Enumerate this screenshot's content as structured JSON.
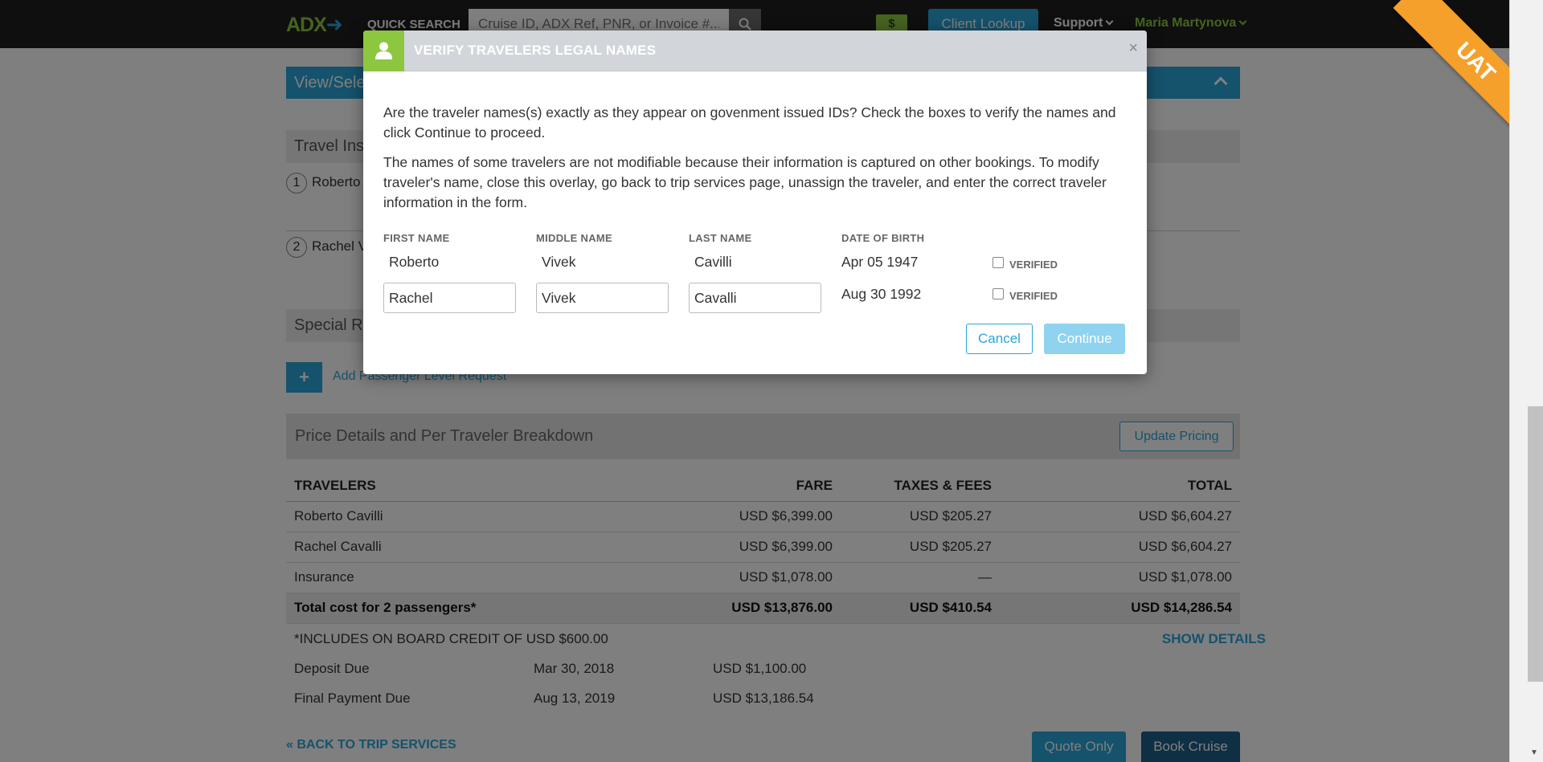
{
  "header": {
    "logo": "ADX",
    "quick_search_label": "QUICK SEARCH",
    "search_placeholder": "Cruise ID, ADX Ref, PNR, or Invoice #...",
    "dollar_label": "$",
    "client_lookup": "Client Lookup",
    "support": "Support",
    "user": "Maria Martynova",
    "env_ribbon": "UAT"
  },
  "page": {
    "view_select_bar": "View/Sele",
    "travel_insurance_title": "Travel Ins",
    "travelers": [
      {
        "num": "1",
        "name": "Roberto"
      },
      {
        "num": "2",
        "name": "Rachel V"
      }
    ],
    "special_requests_title": "Special R",
    "add_request": "Add Passenger Level Request",
    "price_title": "Price Details and Per Traveler Breakdown",
    "update_pricing": "Update Pricing"
  },
  "price_table": {
    "headers": [
      "TRAVELERS",
      "FARE",
      "TAXES & FEES",
      "TOTAL"
    ],
    "rows": [
      [
        "Roberto Cavilli",
        "USD $6,399.00",
        "USD $205.27",
        "USD $6,604.27"
      ],
      [
        "Rachel Cavalli",
        "USD $6,399.00",
        "USD $205.27",
        "USD $6,604.27"
      ],
      [
        "Insurance",
        "USD $1,078.00",
        "—",
        "USD $1,078.00"
      ]
    ],
    "total": [
      "Total cost for 2 passengers*",
      "USD $13,876.00",
      "USD $410.54",
      "USD $14,286.54"
    ],
    "onboard_credit": "*INCLUDES ON BOARD CREDIT OF USD $600.00",
    "show_details": "SHOW DETAILS",
    "deposit": {
      "label": "Deposit Due",
      "date": "Mar 30, 2018",
      "amount": "USD $1,100.00"
    },
    "final": {
      "label": "Final Payment Due",
      "date": "Aug 13, 2019",
      "amount": "USD $13,186.54"
    }
  },
  "footer": {
    "back": "« BACK TO TRIP SERVICES",
    "quote_only": "Quote Only",
    "book_cruise": "Book Cruise"
  },
  "modal": {
    "title": "VERIFY TRAVELERS LEGAL NAMES",
    "close": "×",
    "para1": "Are the traveler names(s) exactly as they appear on govenment issued IDs? Check the boxes to verify the names and click Continue to proceed.",
    "para2": "The names of some travelers are not modifiable because their information is captured on other bookings. To modify traveler's name, close this overlay, go back to trip services page, unassign the traveler, and enter the correct traveler information in the form.",
    "columns": [
      "FIRST NAME",
      "MIDDLE NAME",
      "LAST NAME",
      "DATE OF BIRTH"
    ],
    "travelers": [
      {
        "first": "Roberto",
        "middle": "Vivek",
        "last": "Cavilli",
        "dob": "Apr 05 1947",
        "verified_label": "VERIFIED"
      },
      {
        "first": "Rachel",
        "middle": "Vivek",
        "last": "Cavalli",
        "dob": "Aug 30 1992",
        "verified_label": "VERIFIED"
      }
    ],
    "cancel": "Cancel",
    "continue": "Continue"
  },
  "colors": {
    "accent": "#2aa5d9",
    "brand_green": "#8dc63f",
    "dark_nav": "#1f1f1f",
    "ribbon": "#f5a02a",
    "book_btn": "#1e5f88"
  }
}
